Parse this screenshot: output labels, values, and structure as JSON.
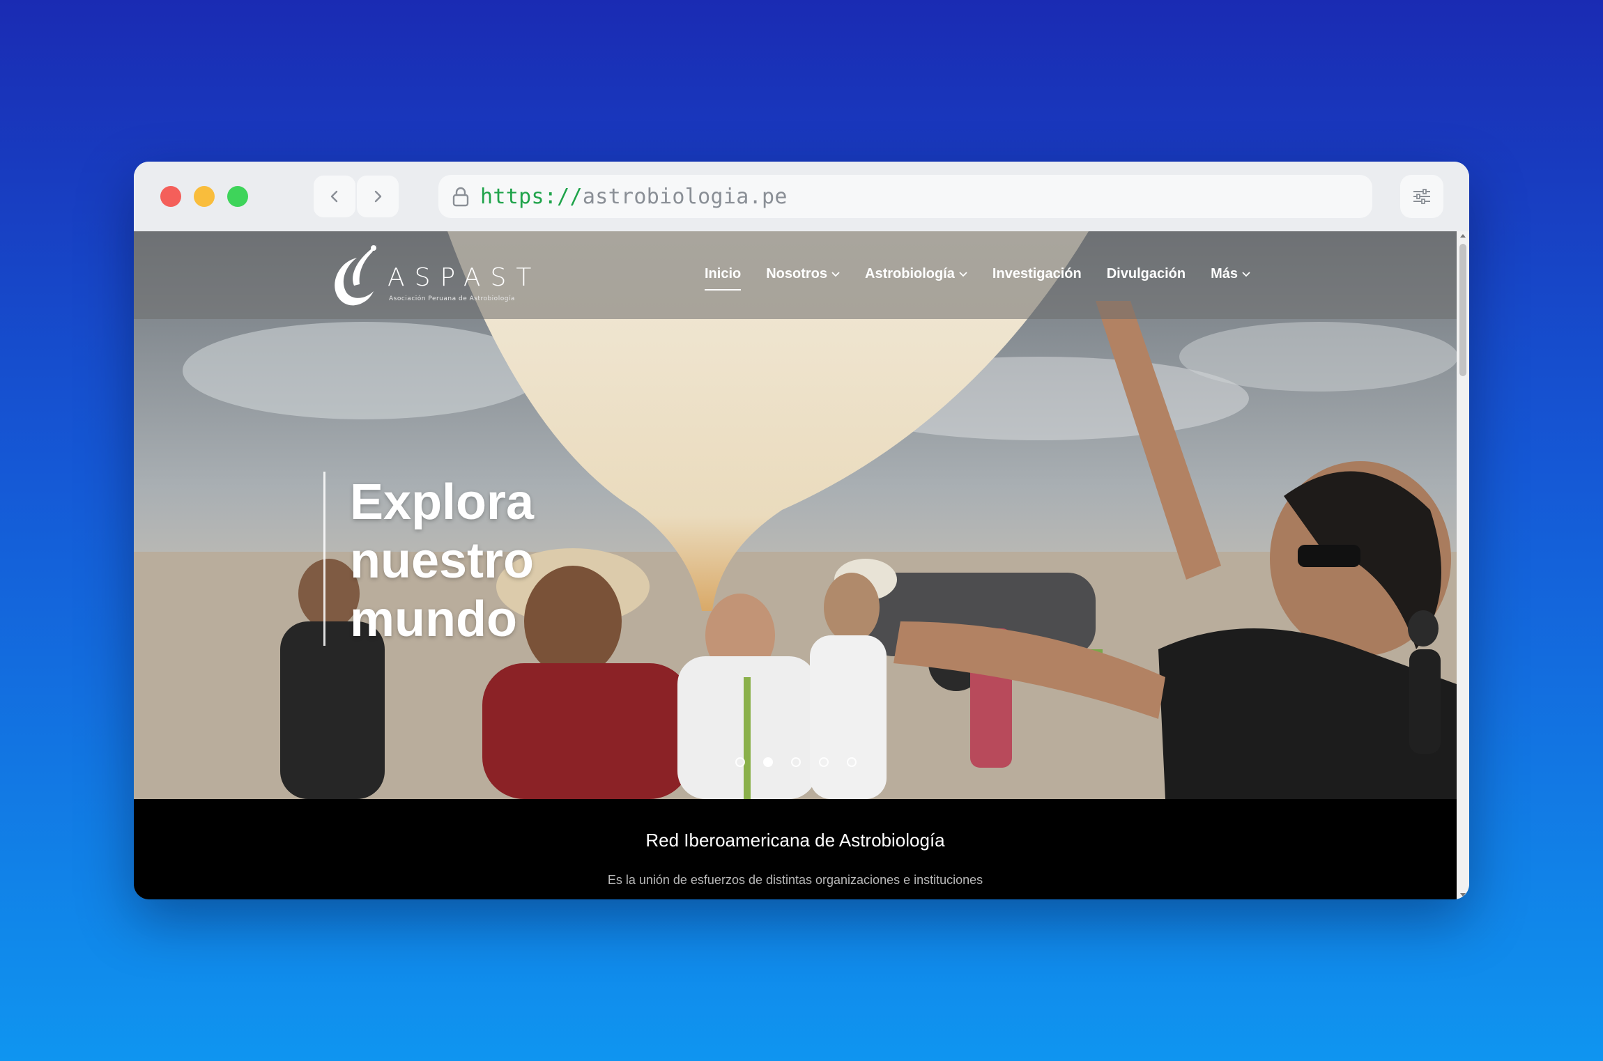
{
  "browser": {
    "url_scheme": "https://",
    "url_host": "astrobiologia.pe",
    "icons": [
      "back-icon",
      "forward-icon",
      "lock-icon",
      "sliders-icon"
    ]
  },
  "site": {
    "logo_name": "ASPAST",
    "logo_subtitle": "Asociación Peruana de Astrobiología",
    "menu": [
      {
        "label": "Inicio",
        "active": true,
        "dropdown": false
      },
      {
        "label": "Nosotros",
        "active": false,
        "dropdown": true
      },
      {
        "label": "Astrobiología",
        "active": false,
        "dropdown": true
      },
      {
        "label": "Investigación",
        "active": false,
        "dropdown": false
      },
      {
        "label": "Divulgación",
        "active": false,
        "dropdown": false
      },
      {
        "label": "Más",
        "active": false,
        "dropdown": true
      }
    ]
  },
  "hero": {
    "title": "Explora nuestro mundo",
    "slides_count": 5,
    "active_slide": 2
  },
  "info": {
    "title": "Red Iberoamericana de Astrobiología",
    "text": "Es la unión de esfuerzos de distintas organizaciones e instituciones"
  },
  "colors": {
    "background_top": "#1a2bb3",
    "background_bottom": "#0f95f0",
    "url_scheme": "#1fa34a"
  }
}
